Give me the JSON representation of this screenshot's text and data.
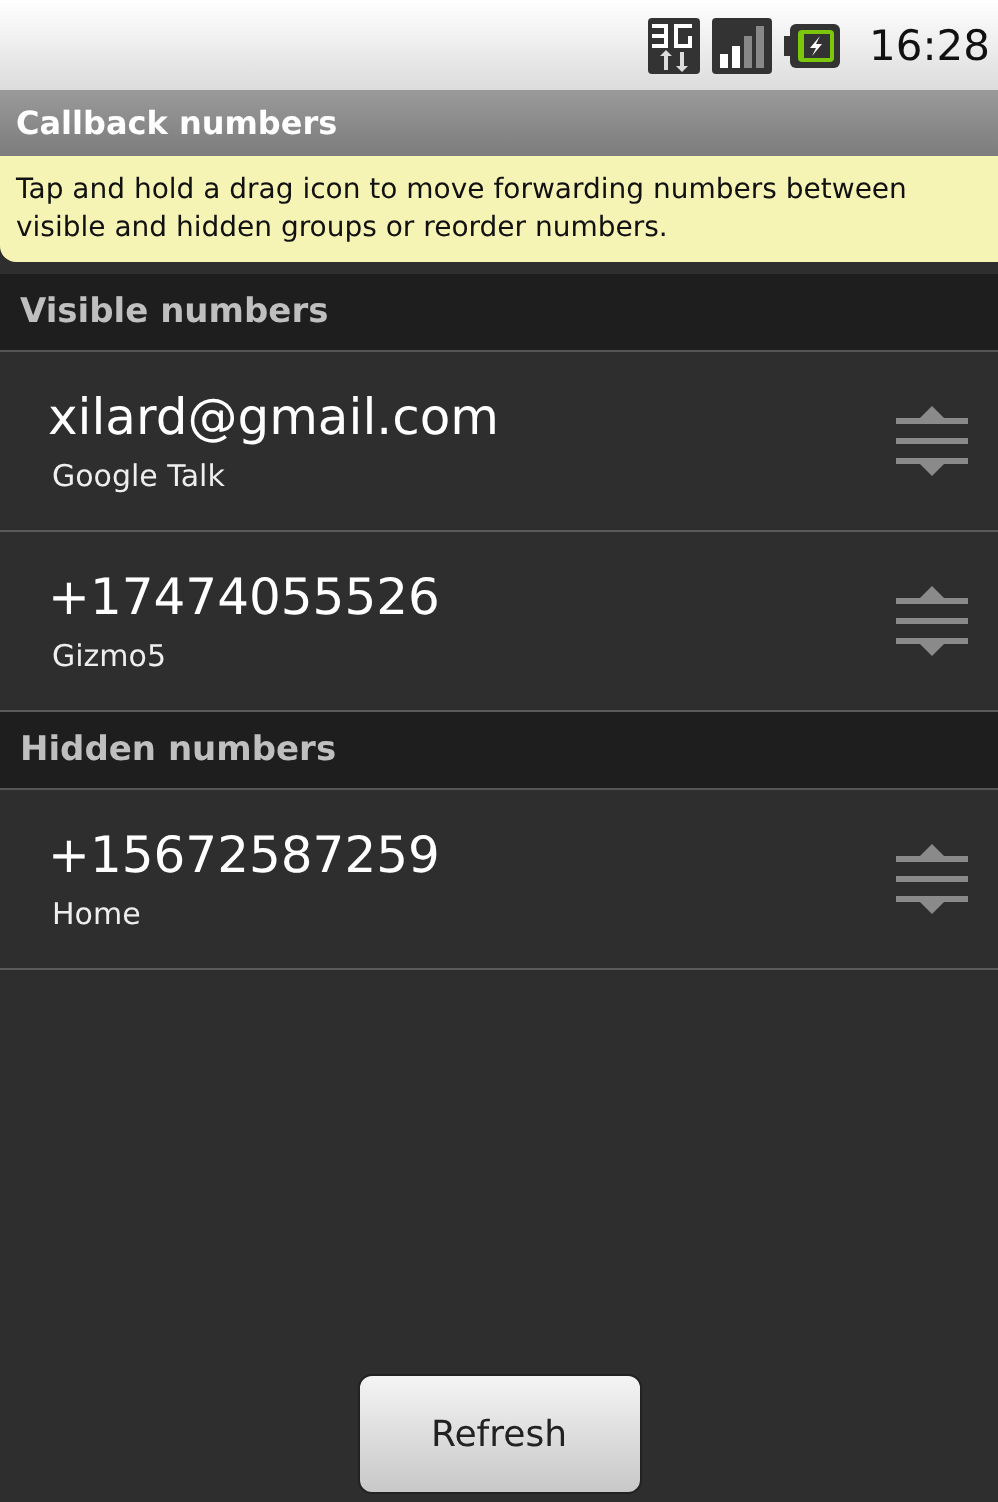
{
  "status_bar": {
    "time": "16:28"
  },
  "title_bar": {
    "title": "Callback numbers"
  },
  "hint": "Tap and hold a drag icon to move forwarding numbers between visible and hidden groups or reorder numbers.",
  "sections": [
    {
      "header": "Visible numbers",
      "items": [
        {
          "number": "xilard@gmail.com",
          "label": "Google Talk"
        },
        {
          "number": "+17474055526",
          "label": "Gizmo5"
        }
      ]
    },
    {
      "header": "Hidden numbers",
      "items": [
        {
          "number": "+15672587259",
          "label": "Home"
        }
      ]
    }
  ],
  "buttons": [
    "Refresh"
  ]
}
